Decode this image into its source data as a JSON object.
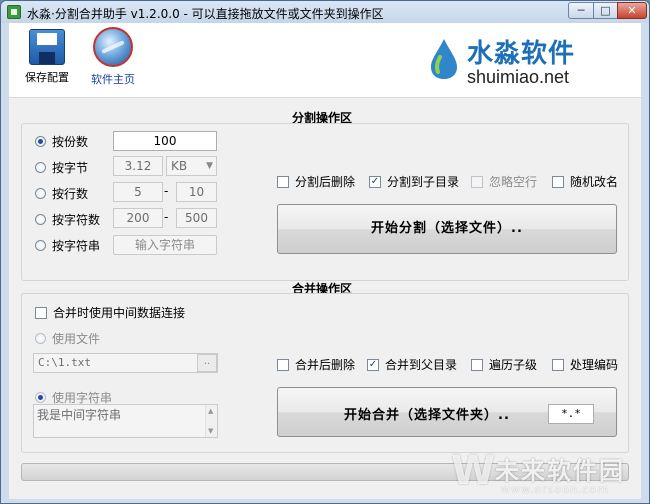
{
  "window": {
    "title": "水淼·分割合并助手 v1.2.0.0 - 可以直接拖放文件或文件夹到操作区",
    "min_label": "─",
    "max_label": "□",
    "close_label": "✕"
  },
  "toolbar": {
    "save_label": "保存配置",
    "home_label": "软件主页"
  },
  "logo": {
    "cn": "水淼软件",
    "en": "shuimiao.net",
    "color": "#1d6fb8"
  },
  "split": {
    "title": "分割操作区",
    "modes": [
      {
        "label": "按份数",
        "selected": true
      },
      {
        "label": "按字节",
        "selected": false
      },
      {
        "label": "按行数",
        "selected": false
      },
      {
        "label": "按字符数",
        "selected": false
      },
      {
        "label": "按字符串",
        "selected": false
      }
    ],
    "parts_value": "100",
    "bytes_value": "3.12",
    "bytes_unit": "KB",
    "lines_from": "5",
    "lines_to": "10",
    "chars_from": "200",
    "chars_to": "500",
    "range_sep": "-",
    "string_button": "输入字符串",
    "options": [
      {
        "label": "分割后删除",
        "checked": false,
        "enabled": true
      },
      {
        "label": "分割到子目录",
        "checked": true,
        "enabled": true
      },
      {
        "label": "忽略空行",
        "checked": false,
        "enabled": false
      },
      {
        "label": "随机改名",
        "checked": false,
        "enabled": true
      }
    ],
    "start_button": "开始分割（选择文件）.."
  },
  "merge": {
    "title": "合并操作区",
    "use_middle_label": "合并时使用中间数据连接",
    "use_middle_checked": false,
    "use_file_label": "使用文件",
    "file_value": "C:\\1.txt",
    "browse_label": "..",
    "use_string_label": "使用字符串",
    "string_value": "我是中间字符串",
    "options": [
      {
        "label": "合并后删除",
        "checked": false
      },
      {
        "label": "合并到父目录",
        "checked": true
      },
      {
        "label": "遍历子级",
        "checked": false
      },
      {
        "label": "处理编码",
        "checked": false
      }
    ],
    "start_button": "开始合并（选择文件夹）..",
    "ext_value": "*.*"
  },
  "progress": {
    "value": 0
  },
  "watermark": {
    "glyph": "W",
    "text": "未来软件园",
    "url": "www.orsoon.com"
  },
  "icons": {
    "save": "save-icon",
    "home": "globe-icon",
    "check": "✓",
    "arrow": "▼",
    "scroll_up": "▲",
    "scroll_down": "▼"
  }
}
